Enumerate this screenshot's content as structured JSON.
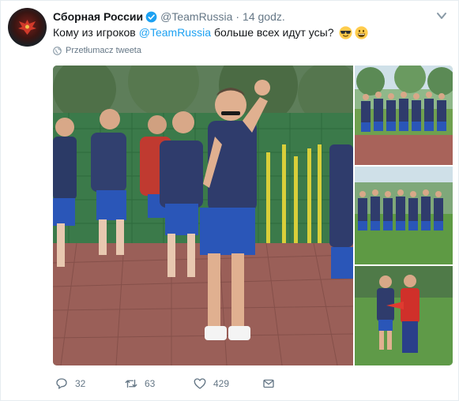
{
  "tweet": {
    "author": {
      "name": "Сборная России",
      "handle": "@TeamRussia",
      "time": "14 godz."
    },
    "text_before": "Кому из игроков",
    "mention": "@TeamRussia",
    "text_after": "больше всех идут усы?",
    "emojis": [
      "sunglasses-emoji",
      "grin-emoji"
    ],
    "translate_label": "Przetłumacz tweeta",
    "actions": {
      "reply_count": "32",
      "retweet_count": "63",
      "like_count": "429"
    }
  },
  "colors": {
    "accent": "#1da1f2",
    "muted": "#657786",
    "text": "#14171a"
  }
}
